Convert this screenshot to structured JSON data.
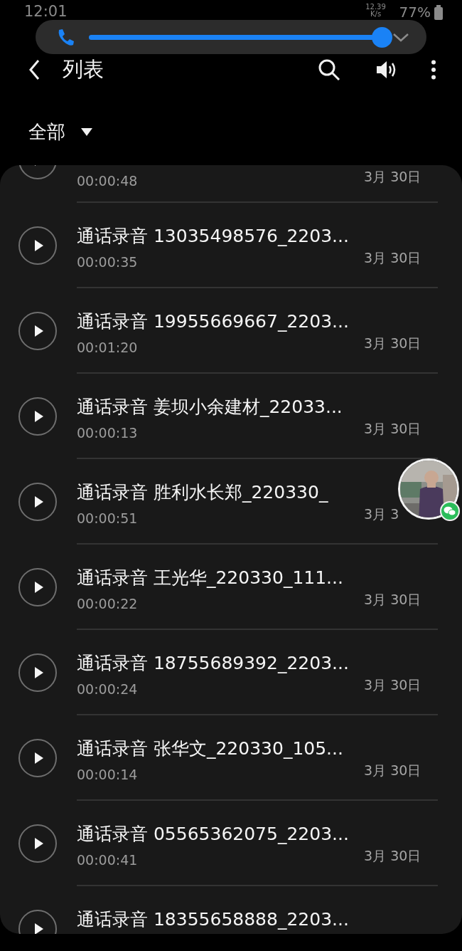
{
  "status_bar": {
    "time": "12:01",
    "speed": "12.39 K/s",
    "battery": "77%"
  },
  "volume_panel": {
    "level": 1.0
  },
  "header": {
    "title": "列表"
  },
  "filter": {
    "label": "全部"
  },
  "recordings": [
    {
      "duration": "00:00:48",
      "date": "3月 30日"
    },
    {
      "title": "通话录音 13035498576_2203...",
      "duration": "00:00:35",
      "date": "3月 30日"
    },
    {
      "title": "通话录音 19955669667_2203...",
      "duration": "00:01:20",
      "date": "3月 30日"
    },
    {
      "title": "通话录音 姜坝小余建材_22033...",
      "duration": "00:00:13",
      "date": "3月 30日"
    },
    {
      "title": "通话录音 胜利水长郑_220330_",
      "duration": "00:00:51",
      "date": "3月 3"
    },
    {
      "title": "通话录音 王光华_220330_111...",
      "duration": "00:00:22",
      "date": "3月 30日"
    },
    {
      "title": "通话录音 18755689392_2203...",
      "duration": "00:00:24",
      "date": "3月 30日"
    },
    {
      "title": "通话录音 张华文_220330_105...",
      "duration": "00:00:14",
      "date": "3月 30日"
    },
    {
      "title": "通话录音 05565362075_2203...",
      "duration": "00:00:41",
      "date": "3月 30日"
    },
    {
      "title": "通话录音 18355658888_2203..."
    }
  ]
}
